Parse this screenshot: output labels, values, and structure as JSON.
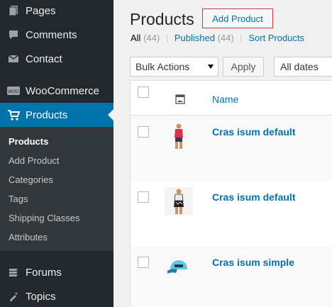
{
  "sidebar": {
    "top_items": [
      {
        "label": "Pages",
        "icon": "pages-icon"
      },
      {
        "label": "Comments",
        "icon": "comments-icon"
      },
      {
        "label": "Contact",
        "icon": "contact-icon"
      },
      {
        "label": "WooCommerce",
        "icon": "woocommerce-icon"
      },
      {
        "label": "Products",
        "icon": "products-icon"
      }
    ],
    "submenu": [
      "Products",
      "Add Product",
      "Categories",
      "Tags",
      "Shipping Classes",
      "Attributes"
    ],
    "bottom_items": [
      {
        "label": "Forums",
        "icon": "forums-icon"
      },
      {
        "label": "Topics",
        "icon": "topics-icon"
      }
    ],
    "woo_badge": "WOO"
  },
  "header": {
    "title": "Products",
    "add_button": "Add Product"
  },
  "filters": {
    "all_label": "All",
    "all_count": "(44)",
    "published_label": "Published",
    "published_count": "(44)",
    "sort_label": "Sort Products",
    "separator": "|"
  },
  "toolbar": {
    "bulk_actions": "Bulk Actions",
    "apply": "Apply",
    "dates": "All dates"
  },
  "table": {
    "name_header": "Name",
    "rows": [
      {
        "name": "Cras isum default"
      },
      {
        "name": "Cras isum default"
      },
      {
        "name": "Cras isum simple"
      }
    ]
  },
  "colors": {
    "sidebar_bg": "#23282d",
    "submenu_bg": "#32373c",
    "accent": "#0073aa",
    "add_button_border": "#c03c3c"
  }
}
